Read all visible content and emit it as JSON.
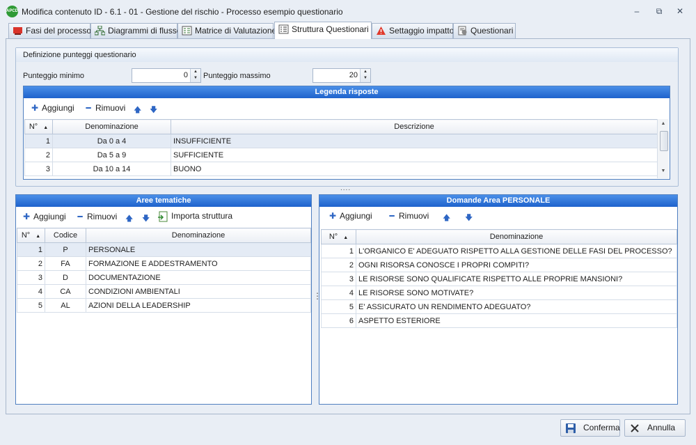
{
  "window": {
    "title": "Modifica contenuto ID - 6.1 - 01 - Gestione del rischio - Processo esempio questionario",
    "app_icon_text": "APCD",
    "controls": {
      "minimize": "–",
      "restore": "⧉",
      "close": "✕"
    }
  },
  "tabs": [
    {
      "label": "Fasi del processo",
      "icon": "process-phases-icon"
    },
    {
      "label": "Diagrammi di flusso",
      "icon": "flowchart-icon"
    },
    {
      "label": "Matrice di Valutazione",
      "icon": "matrix-icon"
    },
    {
      "label": "Struttura Questionari",
      "icon": "questionnaire-structure-icon",
      "active": true
    },
    {
      "label": "Settaggio impatto",
      "icon": "warning-icon"
    },
    {
      "label": "Questionari",
      "icon": "questionnaire-icon"
    }
  ],
  "definizione": {
    "title": "Definizione punteggi questionario",
    "min_label": "Punteggio minimo",
    "min_value": "0",
    "max_label": "Punteggio massimo",
    "max_value": "20"
  },
  "legenda": {
    "title": "Legenda risposte",
    "add_label": "Aggiungi",
    "remove_label": "Rimuovi",
    "columns": [
      "N°",
      "Denominazione",
      "Descrizione"
    ],
    "rows": [
      {
        "n": "1",
        "denominazione": "Da 0 a 4",
        "descrizione": "INSUFFICIENTE"
      },
      {
        "n": "2",
        "denominazione": "Da 5 a 9",
        "descrizione": "SUFFICIENTE"
      },
      {
        "n": "3",
        "denominazione": "Da 10 a 14",
        "descrizione": "BUONO"
      }
    ]
  },
  "splitter": {
    "h_grip": "....",
    "v_grip": "⋮"
  },
  "aree": {
    "title": "Aree tematiche",
    "add_label": "Aggiungi",
    "remove_label": "Rimuovi",
    "import_label": "Importa struttura",
    "columns": [
      "N°",
      "Codice",
      "Denominazione"
    ],
    "rows": [
      {
        "n": "1",
        "codice": "P",
        "denominazione": "PERSONALE"
      },
      {
        "n": "2",
        "codice": "FA",
        "denominazione": "FORMAZIONE E ADDESTRAMENTO"
      },
      {
        "n": "3",
        "codice": "D",
        "denominazione": "DOCUMENTAZIONE"
      },
      {
        "n": "4",
        "codice": "CA",
        "denominazione": "CONDIZIONI AMBIENTALI"
      },
      {
        "n": "5",
        "codice": "AL",
        "denominazione": "AZIONI DELLA LEADERSHIP"
      }
    ]
  },
  "domande": {
    "title": "Domande Area PERSONALE",
    "add_label": "Aggiungi",
    "remove_label": "Rimuovi",
    "columns": [
      "N°",
      "Denominazione"
    ],
    "rows": [
      {
        "n": "1",
        "denominazione": "L'ORGANICO E' ADEGUATO RISPETTO ALLA GESTIONE DELLE FASI DEL PROCESSO?"
      },
      {
        "n": "2",
        "denominazione": "OGNI RISORSA CONOSCE I PROPRI COMPITI?"
      },
      {
        "n": "3",
        "denominazione": "LE RISORSE SONO QUALIFICATE RISPETTO ALLE PROPRIE MANSIONI?"
      },
      {
        "n": "4",
        "denominazione": "LE RISORSE SONO MOTIVATE?"
      },
      {
        "n": "5",
        "denominazione": "E' ASSICURATO UN RENDIMENTO ADEGUATO?"
      },
      {
        "n": "6",
        "denominazione": "ASPETTO ESTERIORE"
      }
    ]
  },
  "buttons": {
    "confirm": "Conferma",
    "cancel": "Annulla"
  },
  "colors": {
    "panel_header": "#2f72d8",
    "selected_row": "#e4ebf5",
    "window_bg": "#e9eef5"
  }
}
